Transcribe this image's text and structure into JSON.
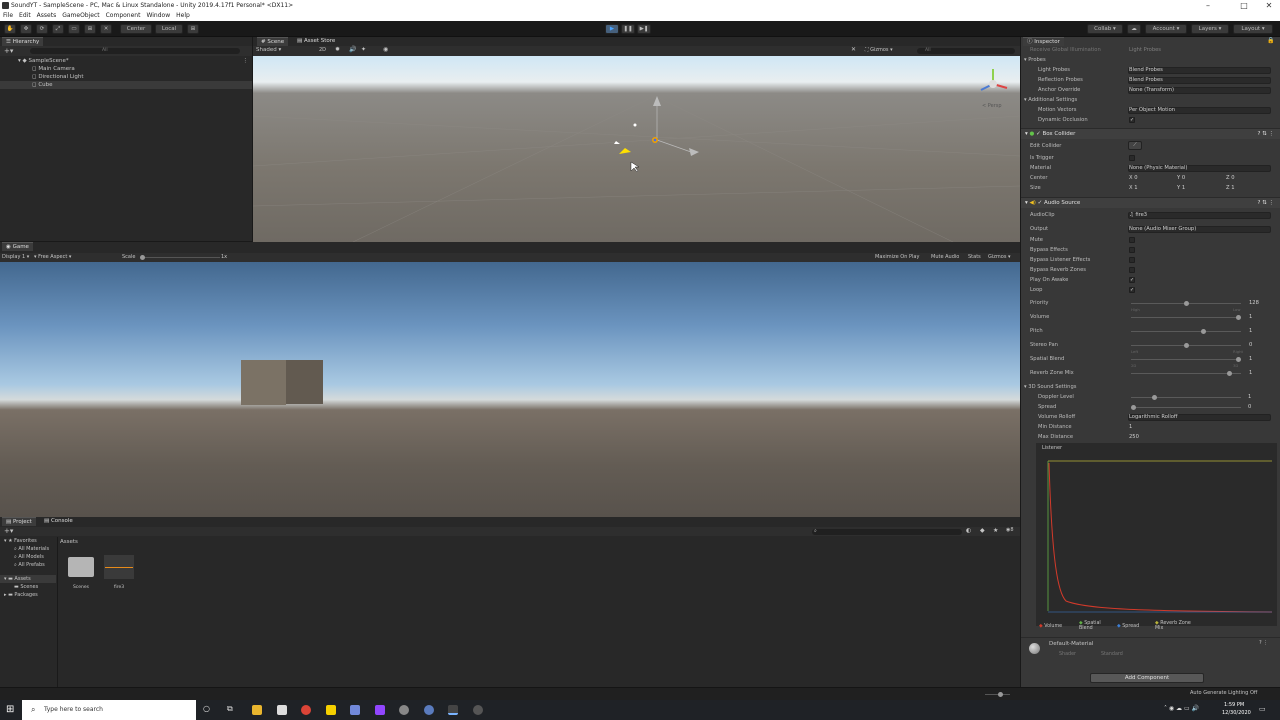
{
  "window": {
    "title": "SoundYT - SampleScene - PC, Mac & Linux Standalone - Unity 2019.4.17f1 Personal* <DX11>"
  },
  "menu": [
    "File",
    "Edit",
    "Assets",
    "GameObject",
    "Component",
    "Window",
    "Help"
  ],
  "toolbar": {
    "pivot": "Center",
    "space": "Local",
    "collab": "Collab",
    "account": "Account",
    "layers": "Layers",
    "layout": "Layout"
  },
  "hierarchy": {
    "tab": "Hierarchy",
    "search_placeholder": "All",
    "scene": "SampleScene*",
    "items": [
      "Main Camera",
      "Directional Light",
      "Cube"
    ]
  },
  "scene": {
    "tabs": [
      "Scene",
      "Asset Store"
    ],
    "shading": "Shaded",
    "mode_2d": "2D",
    "gizmos": "Gizmos",
    "search_placeholder": "All",
    "persp": "< Persp"
  },
  "game": {
    "tab": "Game",
    "display": "Display 1",
    "aspect": "Free Aspect",
    "scale_label": "Scale",
    "scale_value": "1x",
    "options": [
      "Maximize On Play",
      "Mute Audio",
      "Stats",
      "Gizmos"
    ]
  },
  "project": {
    "tabs": [
      "Project",
      "Console"
    ],
    "favorites_label": "Favorites",
    "favorites": [
      "All Materials",
      "All Models",
      "All Prefabs"
    ],
    "assets_label": "Assets",
    "assets_children": [
      "Scenes"
    ],
    "packages_label": "Packages",
    "breadcrumb": "Assets",
    "items": [
      {
        "name": "Scenes",
        "icon": "folder-icon"
      },
      {
        "name": "fire3",
        "icon": "audio-clip-icon"
      }
    ],
    "counter": "8"
  },
  "inspector": {
    "tab": "Inspector",
    "cut_top": [
      "Receive Global Illumination",
      "Light Probes"
    ],
    "probes_label": "Probes",
    "light_probes": {
      "label": "Light Probes",
      "value": "Blend Probes"
    },
    "reflection_probes": {
      "label": "Reflection Probes",
      "value": "Blend Probes"
    },
    "anchor_override": {
      "label": "Anchor Override",
      "value": "None (Transform)"
    },
    "additional_label": "Additional Settings",
    "motion_vectors": {
      "label": "Motion Vectors",
      "value": "Per Object Motion"
    },
    "dynamic_occlusion": {
      "label": "Dynamic Occlusion",
      "value": "✓"
    },
    "box_collider": {
      "title": "Box Collider",
      "edit_collider": "Edit Collider",
      "is_trigger": "Is Trigger",
      "material_label": "Material",
      "material_value": "None (Physic Material)",
      "center_label": "Center",
      "size_label": "Size",
      "center": {
        "x": "0",
        "y": "0",
        "z": "0"
      },
      "size": {
        "x": "1",
        "y": "1",
        "z": "1"
      }
    },
    "audio_source": {
      "title": "Audio Source",
      "audioclip_label": "AudioClip",
      "audioclip_value": "fire3",
      "output_label": "Output",
      "output_value": "None (Audio Mixer Group)",
      "toggles": [
        {
          "label": "Mute",
          "checked": ""
        },
        {
          "label": "Bypass Effects",
          "checked": ""
        },
        {
          "label": "Bypass Listener Effects",
          "checked": ""
        },
        {
          "label": "Bypass Reverb Zones",
          "checked": ""
        },
        {
          "label": "Play On Awake",
          "checked": "✓"
        },
        {
          "label": "Loop",
          "checked": "✓"
        }
      ],
      "sliders": [
        {
          "label": "Priority",
          "value": "128",
          "pos": 0.5,
          "low": "High",
          "high": "Low"
        },
        {
          "label": "Volume",
          "value": "1",
          "pos": 1.0,
          "low": "",
          "high": ""
        },
        {
          "label": "Pitch",
          "value": "1",
          "pos": 0.67,
          "low": "",
          "high": ""
        },
        {
          "label": "Stereo Pan",
          "value": "0",
          "pos": 0.5,
          "low": "Left",
          "high": "Right"
        },
        {
          "label": "Spatial Blend",
          "value": "1",
          "pos": 1.0,
          "low": "2D",
          "high": "3D"
        },
        {
          "label": "Reverb Zone Mix",
          "value": "1",
          "pos": 0.91,
          "low": "",
          "high": ""
        }
      ],
      "sound3d_label": "3D Sound Settings",
      "doppler": {
        "label": "Doppler Level",
        "value": "1",
        "pos": 0.2
      },
      "spread": {
        "label": "Spread",
        "value": "0",
        "pos": 0.0
      },
      "rolloff": {
        "label": "Volume Rolloff",
        "value": "Logarithmic Rolloff"
      },
      "min_distance": {
        "label": "Min Distance",
        "value": "1"
      },
      "max_distance": {
        "label": "Max Distance",
        "value": "250"
      },
      "listener_label": "Listener",
      "graph_legend": [
        "Volume",
        "Spatial Blend",
        "Spread",
        "Reverb Zone Mix"
      ],
      "graph_colors": {
        "volume": "#d23a2a",
        "spatial": "#62b046",
        "spread": "#3c7fd6",
        "reverb": "#b9b339"
      }
    },
    "material": {
      "name": "Default-Material",
      "shader_label": "Shader",
      "shader_value": "Standard"
    },
    "add_component": "Add Component"
  },
  "status": {
    "right": "Auto Generate Lighting Off"
  },
  "taskbar": {
    "search_placeholder": "Type here to search",
    "time": "1:59 PM",
    "date": "12/30/2020"
  }
}
